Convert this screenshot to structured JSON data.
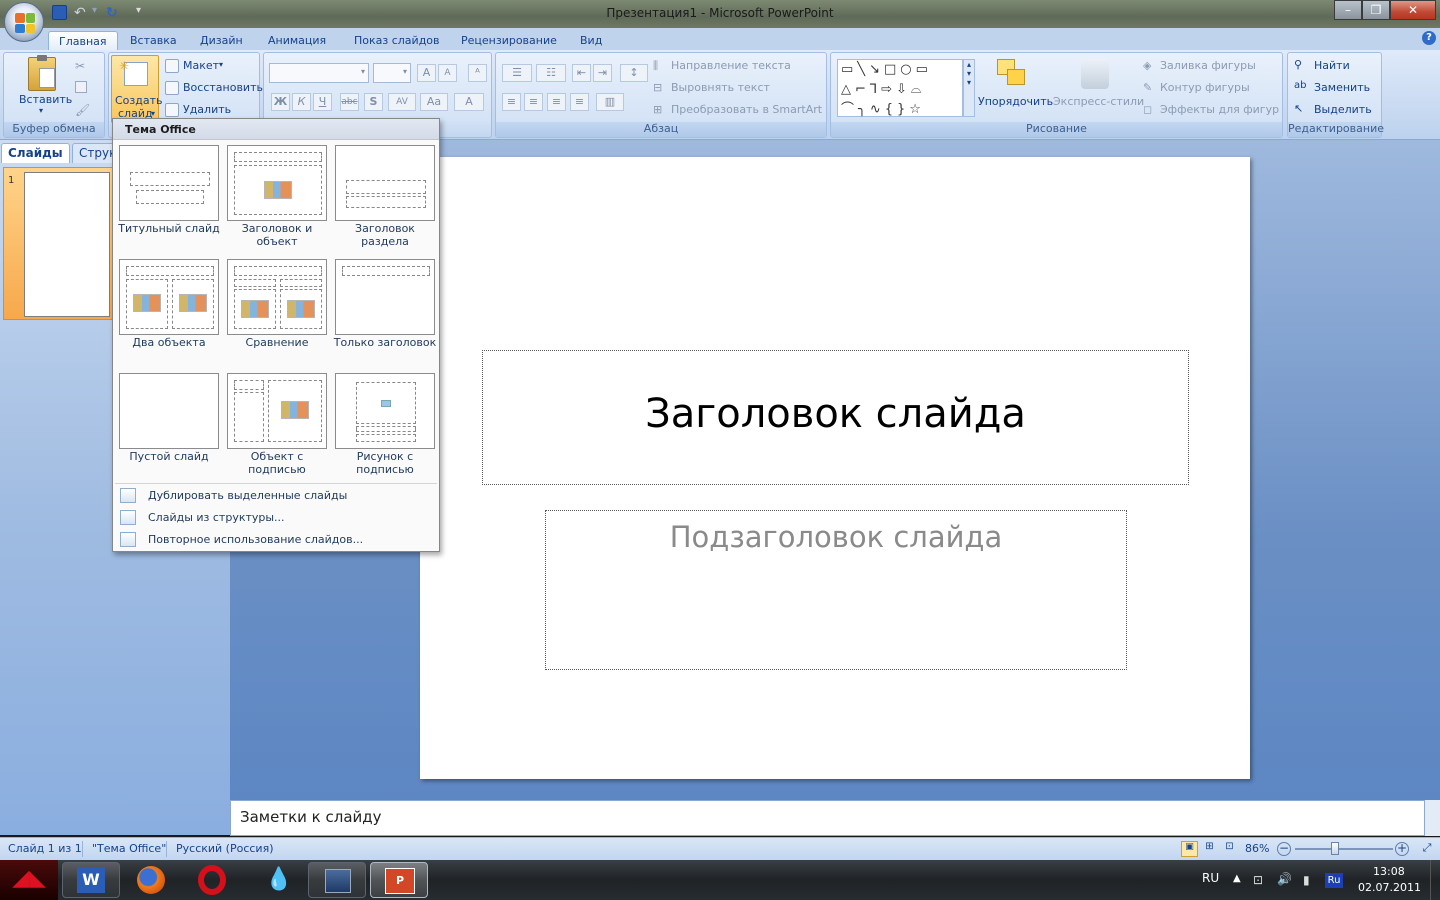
{
  "window": {
    "title": "Презентация1 - Microsoft PowerPoint"
  },
  "tabs": [
    "Главная",
    "Вставка",
    "Дизайн",
    "Анимация",
    "Показ слайдов",
    "Рецензирование",
    "Вид"
  ],
  "ribbon": {
    "clipboard": {
      "label": "Буфер обмена",
      "paste": "Вставить"
    },
    "slides": {
      "new_slide_line1": "Создать",
      "new_slide_line2": "слайд",
      "layout": "Макет",
      "reset": "Восстановить",
      "delete": "Удалить"
    },
    "paragraph": {
      "label": "Абзац",
      "text_direction": "Направление текста",
      "align_text": "Выровнять текст",
      "smartart": "Преобразовать в SmartArt"
    },
    "drawing": {
      "label": "Рисование",
      "arrange": "Упорядочить",
      "quick_styles": "Экспресс-стили",
      "fill": "Заливка фигуры",
      "outline": "Контур фигуры",
      "effects": "Эффекты для фигур"
    },
    "editing": {
      "label": "Редактирование",
      "find": "Найти",
      "replace": "Заменить",
      "select": "Выделить"
    }
  },
  "pane": {
    "tab_slides": "Слайды",
    "tab_outline": "Структ",
    "slide_number": "1"
  },
  "dropdown": {
    "header": "Тема Office",
    "layouts": [
      "Титульный слайд",
      "Заголовок и объект",
      "Заголовок раздела",
      "Два объекта",
      "Сравнение",
      "Только заголовок",
      "Пустой слайд",
      "Объект с подписью",
      "Рисунок с подписью"
    ],
    "menu": [
      "Дублировать выделенные слайды",
      "Слайды из структуры...",
      "Повторное использование слайдов..."
    ]
  },
  "slide": {
    "title": "Заголовок слайда",
    "subtitle": "Подзаголовок слайда"
  },
  "notes": {
    "placeholder": "Заметки к слайду"
  },
  "status": {
    "slide": "Слайд 1 из 1",
    "theme": "\"Тема Office\"",
    "language": "Русский (Россия)",
    "zoom": "86%"
  },
  "taskbar": {
    "lang": "RU",
    "input": "Ru",
    "time": "13:08",
    "date": "02.07.2011"
  }
}
